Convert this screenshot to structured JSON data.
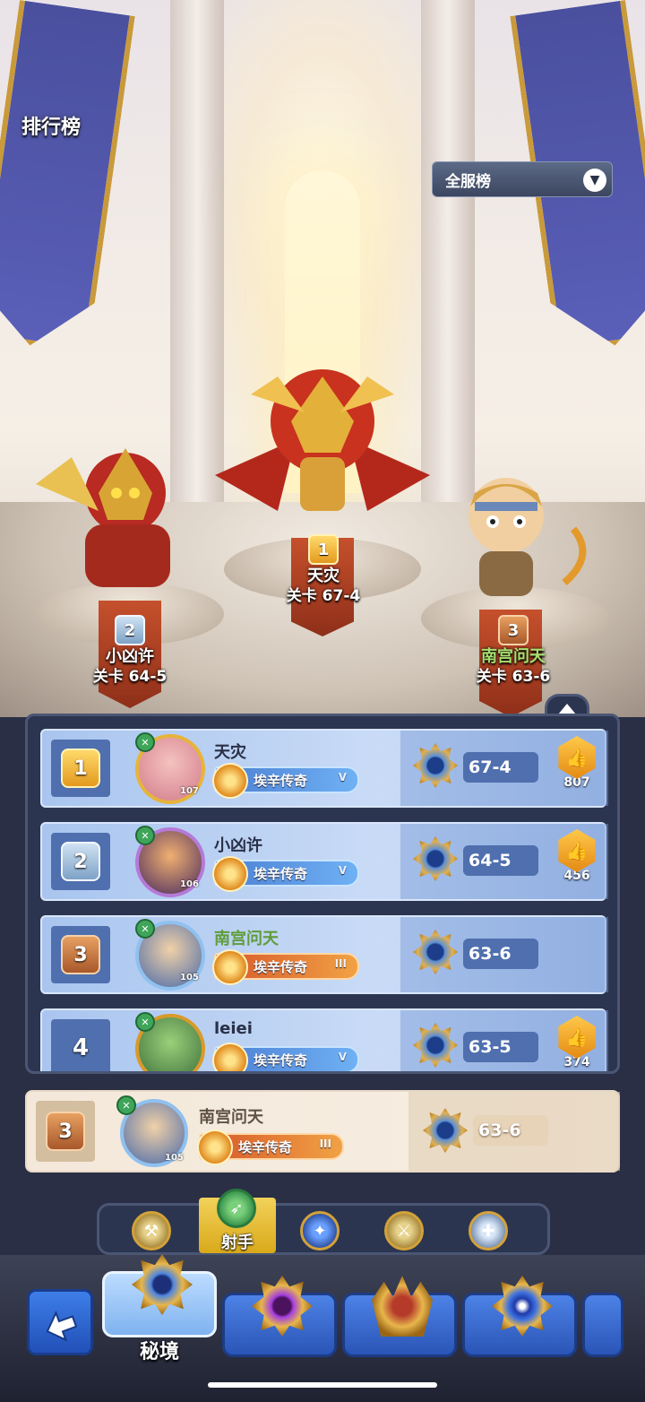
{
  "header": {
    "title": "排行榜",
    "server_selector": "全服榜"
  },
  "podium": [
    {
      "rank": "1",
      "name": "天灾",
      "stage": "关卡 67-4"
    },
    {
      "rank": "2",
      "name": "小凶许",
      "stage": "关卡 64-5"
    },
    {
      "rank": "3",
      "name": "南宫问天",
      "stage": "关卡 63-6"
    }
  ],
  "leaderboard": {
    "rows": [
      {
        "rank": "1",
        "name": "天灾",
        "level": "107",
        "title": "埃辛传奇",
        "tier": "V",
        "stage": "67-4",
        "likes": "807"
      },
      {
        "rank": "2",
        "name": "小凶许",
        "level": "106",
        "title": "埃辛传奇",
        "tier": "V",
        "stage": "64-5",
        "likes": "456"
      },
      {
        "rank": "3",
        "name": "南宫问天",
        "level": "105",
        "title": "埃辛传奇",
        "tier": "III",
        "stage": "63-6",
        "likes": ""
      },
      {
        "rank": "4",
        "name": "leiei",
        "level": "",
        "title": "埃辛传奇",
        "tier": "V",
        "stage": "63-5",
        "likes": "374"
      }
    ]
  },
  "self_row": {
    "rank": "3",
    "name": "南宫问天",
    "level": "105",
    "title": "埃辛传奇",
    "tier": "III",
    "stage": "63-6"
  },
  "class_filter": {
    "selected_label": "射手",
    "icons": [
      "axe-icon",
      "bow-icon",
      "staff-icon",
      "sword-icon",
      "cross-icon"
    ]
  },
  "modes": {
    "active_label": "秘境",
    "icons": [
      "back-arrow-icon",
      "secret-realm-icon",
      "purple-eye-emblem-icon",
      "crown-emblem-icon",
      "compass-emblem-icon"
    ]
  },
  "colors": {
    "gold": "#e39a1e",
    "silver": "#7ea2c6",
    "bronze": "#a8582a",
    "row_bg": "#c9dbf6",
    "panel_bg": "#2c3550",
    "green_name": "#5f9c39"
  }
}
